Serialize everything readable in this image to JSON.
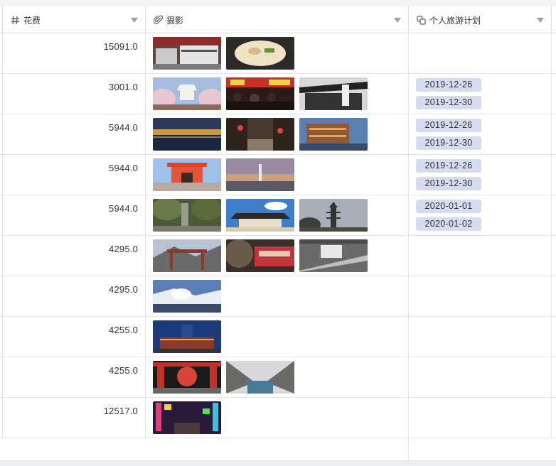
{
  "columns": [
    {
      "label": "花费",
      "icon": "hash-icon"
    },
    {
      "label": "摄影",
      "icon": "paperclip-icon"
    },
    {
      "label": "个人旅游计划",
      "icon": "link-record-icon"
    }
  ],
  "rows": [
    {
      "cost": "15091.0",
      "photos": [
        "train-station",
        "ramen-bowl"
      ],
      "plans": []
    },
    {
      "cost": "3001.0",
      "photos": [
        "castle-cherry-blossom",
        "night-market-crowd",
        "temple-gate-dark"
      ],
      "plans": [
        "2019-12-26",
        "2019-12-30"
      ]
    },
    {
      "cost": "5944.0",
      "photos": [
        "river-night-lights",
        "old-street-lanterns",
        "wooden-pavilion-dusk"
      ],
      "plans": [
        "2019-12-26",
        "2019-12-30"
      ]
    },
    {
      "cost": "5944.0",
      "photos": [
        "red-shrine-gate",
        "tower-sunset-city"
      ],
      "plans": [
        "2019-12-26",
        "2019-12-30"
      ]
    },
    {
      "cost": "5944.0",
      "photos": [
        "forest-stone-path",
        "great-temple-blue-sky",
        "pagoda-silhouette"
      ],
      "plans": [
        "2020-01-01",
        "2020-01-02"
      ]
    },
    {
      "cost": "4295.0",
      "photos": [
        "mountain-town-gate",
        "red-train-forest",
        "cable-car-slope"
      ],
      "plans": []
    },
    {
      "cost": "4295.0",
      "photos": [
        "snowy-hot-spring"
      ],
      "plans": []
    },
    {
      "cost": "4255.0",
      "photos": [
        "station-night-blue"
      ],
      "plans": []
    },
    {
      "cost": "4255.0",
      "photos": [
        "red-lantern-gate",
        "snowy-stream-valley"
      ],
      "plans": []
    },
    {
      "cost": "12517.0",
      "photos": [
        "neon-street-night"
      ],
      "plans": []
    }
  ],
  "colors": {
    "tag_bg": "#d6dbf0",
    "border": "#e4e5e8",
    "header_caret": "#9aa0a6"
  }
}
